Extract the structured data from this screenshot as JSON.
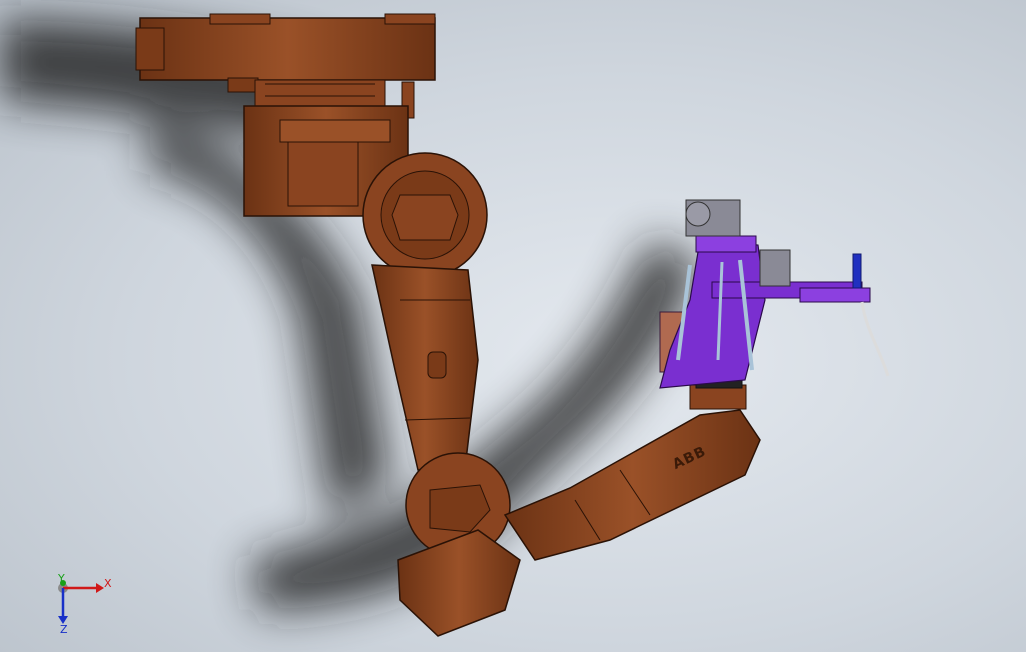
{
  "viewport": {
    "brand_marking": "ABB",
    "colors": {
      "robot_body": "#8a4420",
      "robot_shade": "#5e2c12",
      "end_effector": "#7a2fd0",
      "background": "#d3dae2"
    }
  },
  "triad": {
    "x_label": "X",
    "y_label": "Y",
    "z_label": "Z",
    "x_color": "#d01818",
    "y_color": "#18a018",
    "z_color": "#1830c8"
  }
}
